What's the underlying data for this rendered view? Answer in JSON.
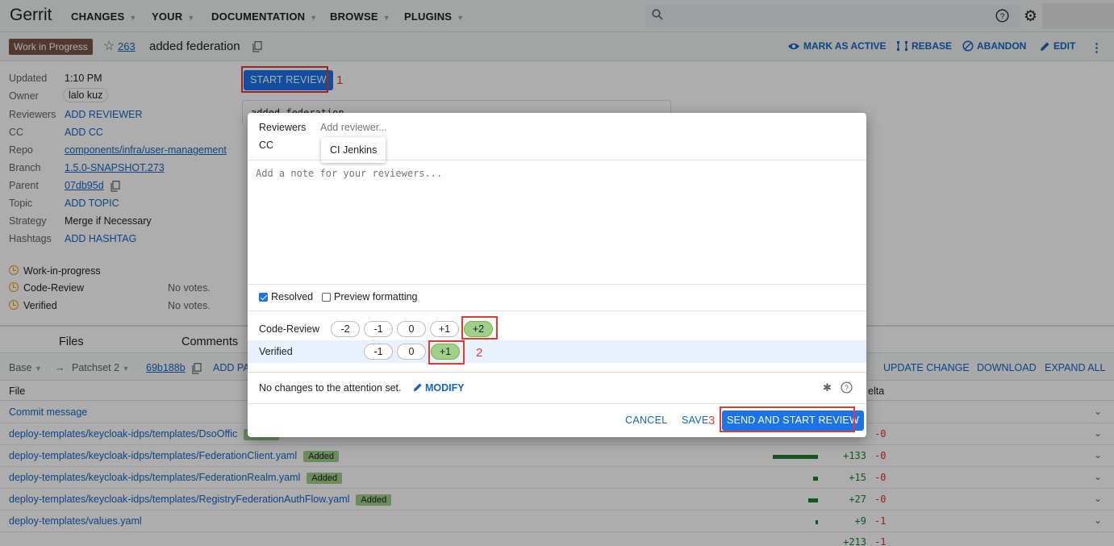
{
  "topnav": {
    "logo": "Gerrit",
    "items": [
      "CHANGES",
      "YOUR",
      "DOCUMENTATION",
      "BROWSE",
      "PLUGINS"
    ]
  },
  "change": {
    "status": "Work in Progress",
    "number": "263",
    "title": "added federation",
    "actions": [
      "MARK AS ACTIVE",
      "REBASE",
      "ABANDON",
      "EDIT"
    ]
  },
  "meta": {
    "updated_label": "Updated",
    "updated": "1:10 PM",
    "owner_label": "Owner",
    "owner": "lalo kuz",
    "reviewers_label": "Reviewers",
    "reviewers": "ADD REVIEWER",
    "cc_label": "CC",
    "cc": "ADD CC",
    "repo_label": "Repo",
    "repo": "components/infra/user-management",
    "branch_label": "Branch",
    "branch": "1.5.0-SNAPSHOT.273",
    "parent_label": "Parent",
    "parent": "07db95d",
    "topic_label": "Topic",
    "topic": "ADD TOPIC",
    "strategy_label": "Strategy",
    "strategy": "Merge if Necessary",
    "hashtags_label": "Hashtags",
    "hashtags": "ADD HASHTAG"
  },
  "labels": {
    "wip": "Work-in-progress",
    "code_review": "Code-Review",
    "verified": "Verified",
    "no_votes": "No votes."
  },
  "start_review": "START REVIEW",
  "commit_msg_partial": "added federation",
  "annotations": {
    "n1": "1",
    "n2": "2",
    "n3": "3"
  },
  "tabs": [
    "Files",
    "Comments"
  ],
  "filebar": {
    "base": "Base",
    "patchset": "Patchset 2",
    "commit": "69b188b",
    "add_patchset": "ADD PA",
    "update_change": "UPDATE CHANGE",
    "download": "DOWNLOAD",
    "expand_all": "EXPAND ALL"
  },
  "files_header": {
    "file": "File",
    "delta": "elta"
  },
  "files": [
    {
      "name": "Commit message",
      "added": "",
      "plus": "",
      "minus": "",
      "bar": 0
    },
    {
      "name": "deploy-templates/keycloak-idps/templates/DsoOffic",
      "added": "Added",
      "plus": "",
      "minus": "-0",
      "bar": 0.2
    },
    {
      "name": "deploy-templates/keycloak-idps/templates/FederationClient.yaml",
      "added": "Added",
      "plus": "+133",
      "minus": "-0",
      "bar": 1
    },
    {
      "name": "deploy-templates/keycloak-idps/templates/FederationRealm.yaml",
      "added": "Added",
      "plus": "+15",
      "minus": "-0",
      "bar": 0.1
    },
    {
      "name": "deploy-templates/keycloak-idps/templates/RegistryFederationAuthFlow.yaml",
      "added": "Added",
      "plus": "+27",
      "minus": "-0",
      "bar": 0.2
    },
    {
      "name": "deploy-templates/values.yaml",
      "added": "",
      "plus": "+9",
      "minus": "-1",
      "bar": 0.06
    }
  ],
  "files_total": {
    "plus": "+213",
    "minus": "-1"
  },
  "dialog": {
    "reviewers_label": "Reviewers",
    "reviewer_placeholder": "Add reviewer...",
    "cc_label": "CC",
    "suggestion": "CI Jenkins",
    "note_placeholder": "Add a note for your reviewers...",
    "resolved": "Resolved",
    "preview": "Preview formatting",
    "code_review_label": "Code-Review",
    "code_review_votes": [
      "-2",
      "-1",
      "0",
      "+1",
      "+2"
    ],
    "code_review_selected": "+2",
    "verified_label": "Verified",
    "verified_votes": [
      "-1",
      "0",
      "+1"
    ],
    "verified_selected": "+1",
    "attention": "No changes to the attention set.",
    "modify": "MODIFY",
    "cancel": "CANCEL",
    "save": "SAVE",
    "send": "SEND AND START REVIEW"
  }
}
